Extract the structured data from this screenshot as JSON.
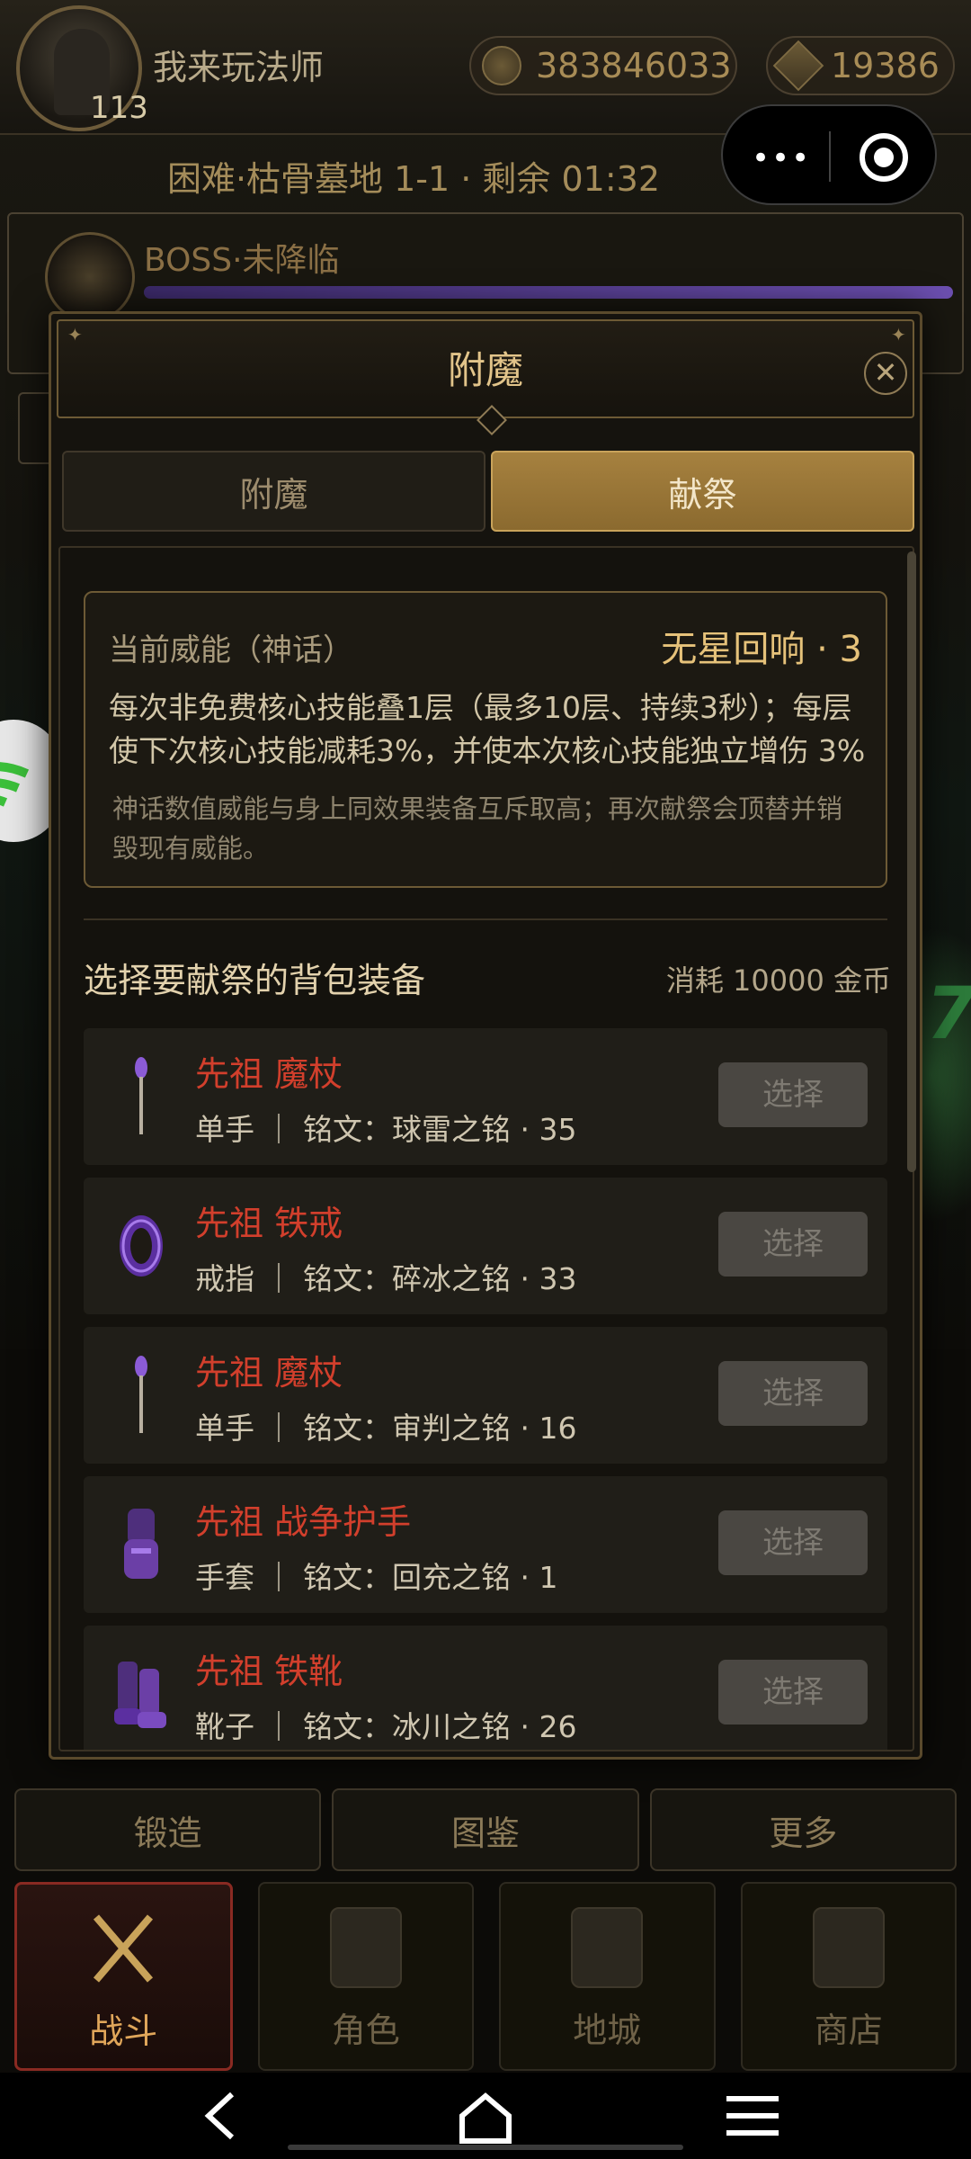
{
  "player": {
    "name": "我来玩法师",
    "level": "113",
    "gold": "383846033",
    "gems": "19386"
  },
  "stage": {
    "text": "困难·枯骨墓地 1-1 · 剩余 01:32"
  },
  "boss": {
    "status": "BOSS·未降临"
  },
  "dialog": {
    "title": "附魔",
    "tabs": [
      {
        "label": "附魔"
      },
      {
        "label": "献祭"
      }
    ],
    "active_tab": "献祭",
    "power": {
      "label": "当前威能（神话）",
      "name": "无星回响 · 3",
      "description": "每次非免费核心技能叠1层（最多10层、持续3秒）；每层使下次核心技能减耗3%，并使本次核心技能独立增伤 3%",
      "note": "神话数值威能与身上同效果装备互斥取高；再次献祭会顶替并销毁现有威能。"
    },
    "section_title": "选择要献祭的背包装备",
    "cost": "消耗 10000 金币",
    "items": [
      {
        "name": "先祖 魔杖",
        "meta": "单手 ｜ 铭文：球雷之铭 · 35",
        "button": "选择",
        "icon": "wand-icon"
      },
      {
        "name": "先祖 铁戒",
        "meta": "戒指 ｜ 铭文：碎冰之铭 · 33",
        "button": "选择",
        "icon": "ring-icon"
      },
      {
        "name": "先祖 魔杖",
        "meta": "单手 ｜ 铭文：审判之铭 · 16",
        "button": "选择",
        "icon": "wand-icon"
      },
      {
        "name": "先祖 战争护手",
        "meta": "手套 ｜ 铭文：回充之铭 · 1",
        "button": "选择",
        "icon": "gauntlet-icon"
      },
      {
        "name": "先祖 铁靴",
        "meta": "靴子 ｜ 铭文：冰川之铭 · 26",
        "button": "选择",
        "icon": "boots-icon"
      }
    ]
  },
  "sub_nav": [
    {
      "label": "锻造"
    },
    {
      "label": "图鉴"
    },
    {
      "label": "更多"
    }
  ],
  "main_nav": [
    {
      "label": "战斗"
    },
    {
      "label": "角色"
    },
    {
      "label": "地城"
    },
    {
      "label": "商店"
    }
  ],
  "colors": {
    "accent_gold": "#a6813f",
    "item_rarity": "#d23f2c",
    "active_tab_red": "#8a2a22"
  }
}
